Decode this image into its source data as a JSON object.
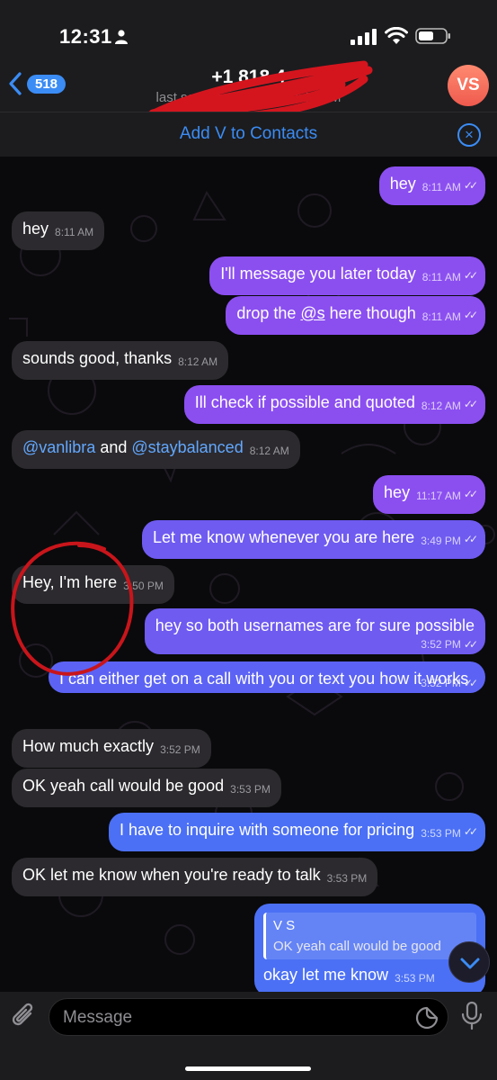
{
  "status_bar": {
    "time": "12:31"
  },
  "header": {
    "back_badge": "518",
    "phone": "+1 818 4",
    "status": "last seen yesterday at 3:45 PM",
    "avatar_initials": "VS"
  },
  "banner": {
    "add_contact": "Add V to Contacts",
    "close": "×"
  },
  "messages": [
    {
      "text": "hey",
      "time": "8:11 AM",
      "ticks": "✓✓"
    },
    {
      "text": "hey",
      "time": "8:11 AM"
    },
    {
      "text": "I'll message you later today",
      "time": "8:11 AM",
      "ticks": "✓✓"
    },
    {
      "text_prefix": "drop the ",
      "text_underlined": "@s",
      "text_suffix": " here though",
      "time": "8:11 AM",
      "ticks": "✓✓"
    },
    {
      "text": "sounds good, thanks",
      "time": "8:12 AM"
    },
    {
      "text": "Ill check if possible and quoted",
      "time": "8:12 AM",
      "ticks": "✓✓"
    },
    {
      "mention1": "@vanlibra",
      "connector": " and ",
      "mention2": "@staybalanced",
      "time": "8:12 AM"
    },
    {
      "text": "hey",
      "time": "11:17 AM",
      "ticks": "✓✓"
    },
    {
      "text": "Let me know whenever you are here",
      "time": "3:49 PM",
      "ticks": "✓✓"
    },
    {
      "text": "Hey, I'm here",
      "time": "3:50 PM"
    },
    {
      "text": "hey so both usernames are for sure possible",
      "time": "3:52 PM",
      "ticks": "✓✓"
    },
    {
      "text": "I can either get on a call with you or text you how it works",
      "time": "3:52 PM",
      "ticks": "✓✓"
    },
    {
      "text": "How much exactly",
      "time": "3:52 PM"
    },
    {
      "text": "OK yeah call would be good",
      "time": "3:53 PM"
    },
    {
      "text": "I have to inquire with someone for pricing",
      "time": "3:53 PM",
      "ticks": "✓✓"
    },
    {
      "text": "OK let me know when you're ready to talk",
      "time": "3:53 PM"
    },
    {
      "reply_name": "V S",
      "reply_text": "OK yeah call would be good",
      "text": "okay let me know",
      "time": "3:53 PM"
    }
  ],
  "input": {
    "placeholder": "Message"
  },
  "colors": {
    "accent": "#3b8cf4",
    "outgoing_bubble": "#8b4ff0",
    "incoming_bubble": "#2c2a2e",
    "avatar": "#ef5a4e",
    "annotation_circle": "#c8151b"
  },
  "icons": [
    "person-icon",
    "signal-icon",
    "wifi-icon",
    "battery-icon",
    "chevron-left-icon",
    "close-circle-icon",
    "chevron-down-icon",
    "paperclip-icon",
    "sticker-icon",
    "microphone-icon"
  ]
}
